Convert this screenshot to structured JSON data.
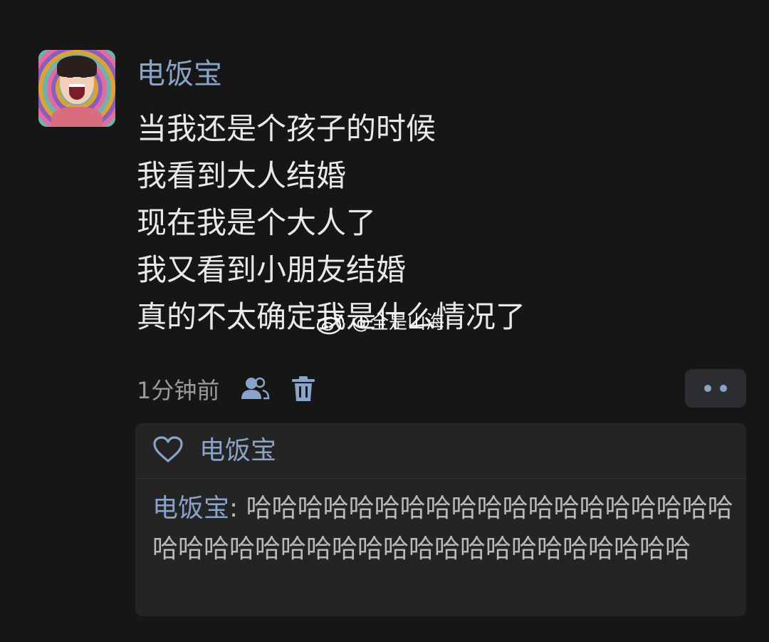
{
  "post": {
    "username": "电饭宝",
    "lines": [
      "当我还是个孩子的时候",
      "我看到大人结婚",
      "现在我是个大人了",
      "我又看到小朋友结婚",
      "真的不太确定我是什么情况了"
    ],
    "watermark": "@全是山海",
    "time": "1分钟前",
    "icons": {
      "friend": "friends-icon",
      "delete": "trash-icon",
      "more": "more-dots-icon",
      "like": "heart-icon",
      "watermark": "weibo-logo-icon"
    }
  },
  "likes": {
    "liker": "电饭宝"
  },
  "reply": {
    "author": "电饭宝",
    "separator": ": ",
    "text": "哈哈哈哈哈哈哈哈哈哈哈哈哈哈哈哈哈哈哈哈哈哈哈哈哈哈哈哈哈哈哈哈哈哈哈哈哈哈哈哈"
  },
  "colors": {
    "background": "#161616",
    "accent": "#8aa3c8",
    "text": "#e9e9e9",
    "muted": "#9a9a9a",
    "card": "#242424"
  }
}
